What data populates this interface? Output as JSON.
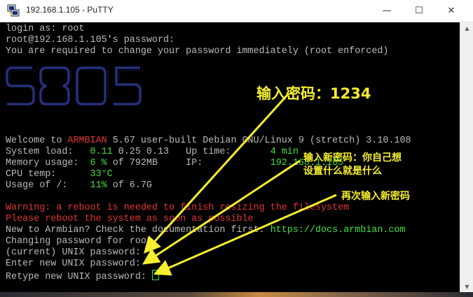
{
  "window": {
    "title": "192.168.1.105 - PuTTY",
    "buttons": {
      "minimize": "—",
      "maximize": "☐",
      "close": "✕"
    }
  },
  "terminal": {
    "login_prompt": "login as: root",
    "password_prompt": "root@192.168.1.105's password:",
    "change_notice": "You are required to change your password immediately (root enforced)",
    "banner_ascii": [
      " ____   ___   ___   ____ ",
      "/ ___| ( _ ) / _ \\ | ___|",
      "\\___ \\ / _ \\| | | ||___ \\",
      " ___) | (_) | |_| | ___) |",
      "|____/ \\___/ \\___/ |____/"
    ],
    "welcome": {
      "prefix": "Welcome to ",
      "distro": "ARMBIAN",
      "suffix": " 5.67 user-built Debian GNU/Linux 9 (stretch) 3.10.108"
    },
    "system_load_label": "System load:   ",
    "system_load_value": "0.11",
    "system_load_rest": " 0.25 0.13   Up time:       ",
    "uptime_value": "4 min",
    "memory_label": "Memory usage:  ",
    "memory_value": "6 %",
    "memory_rest": " of 792MB     IP:            ",
    "ip_value": "192.168.1.105",
    "cpu_label": "CPU temp:      ",
    "cpu_value": "33°C",
    "usage_label": "Usage of /:    ",
    "usage_value": "11%",
    "usage_rest": " of 6.7G",
    "warning_line1": "Warning: a reboot is needed to finish resizing the filesystem",
    "warning_line2": "Please reboot the system as soon as possible",
    "doc_prefix": "New to Armbian? Check the documentation first: ",
    "doc_url": "https://docs.armbian.com",
    "changing": "Changing password for root.",
    "current_pw": "(current) UNIX password:",
    "new_pw": "Enter new UNIX password:",
    "retype_pw": "Retype new UNIX password: "
  },
  "annotations": {
    "main": "输入密码：1234",
    "new_password": "输入新密码：你自己想设置什么就是什么",
    "retype": "再次输入新密码",
    "color": "#f6ef2f"
  },
  "colors": {
    "terminal_bg": "#000000",
    "terminal_fg": "#bbbbbb",
    "red": "#e03535",
    "green": "#3ee03e",
    "banner": "#1f2a8a"
  }
}
